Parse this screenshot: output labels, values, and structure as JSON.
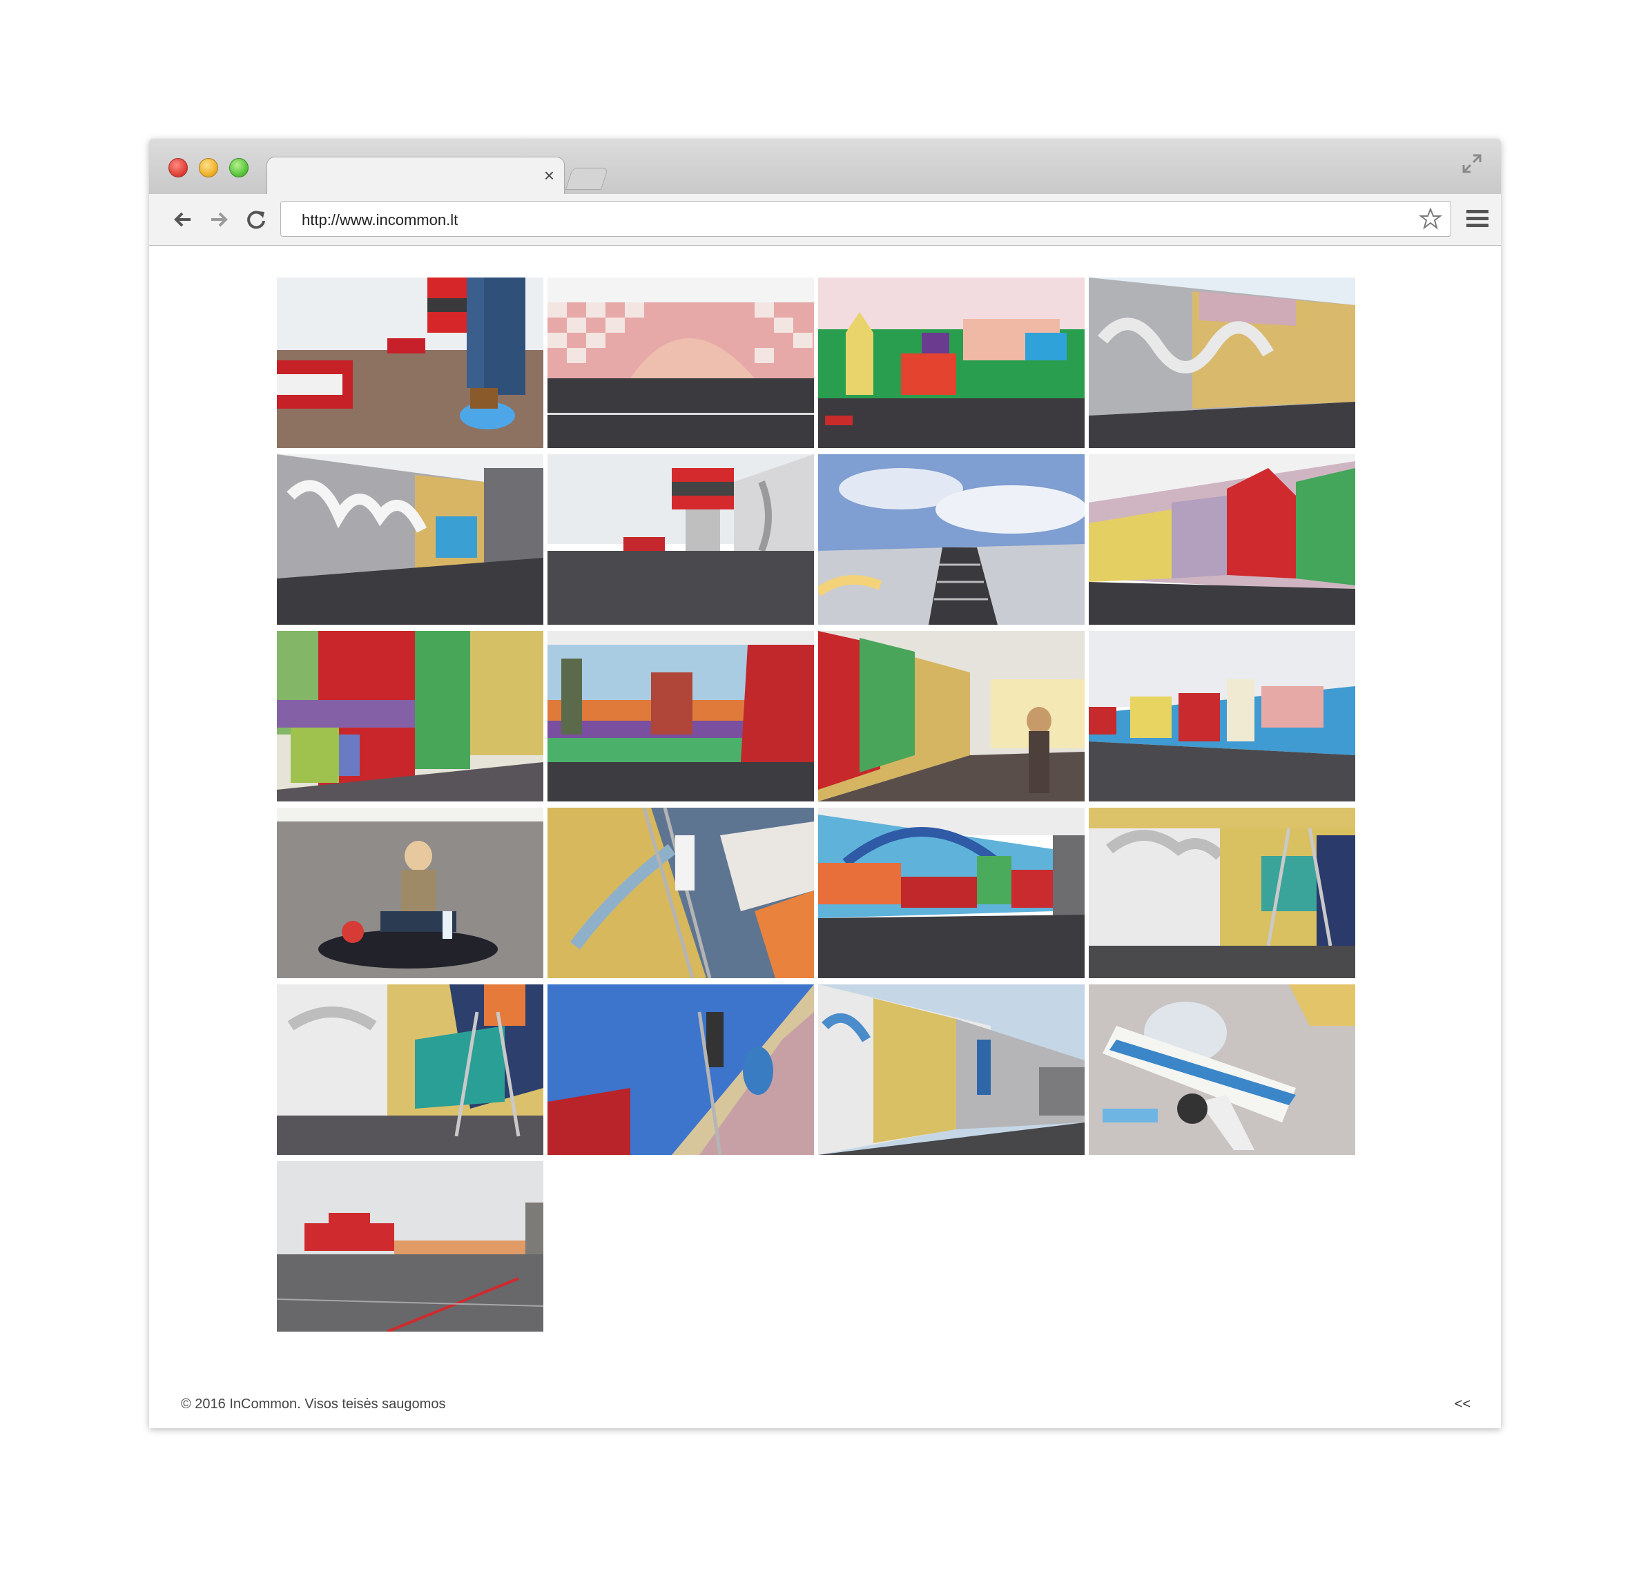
{
  "browser": {
    "url": "http://www.incommon.lt",
    "tab_close": "×"
  },
  "gallery": {
    "photos": [
      {
        "name": "fire-truck-runway-photo"
      },
      {
        "name": "checkered-wall-photo"
      },
      {
        "name": "spray-can-mural-photo"
      },
      {
        "name": "graffiti-wall-photo"
      },
      {
        "name": "vilnius-graffiti-photo"
      },
      {
        "name": "control-tower-photo"
      },
      {
        "name": "sky-roof-photo"
      },
      {
        "name": "cathedral-mural-photo"
      },
      {
        "name": "red-wall-painter-photo"
      },
      {
        "name": "castle-mural-photo"
      },
      {
        "name": "sunset-person-photo"
      },
      {
        "name": "full-mural-photo"
      },
      {
        "name": "woman-paints-photo"
      },
      {
        "name": "ladder-painter-photo"
      },
      {
        "name": "bridge-mural-photo"
      },
      {
        "name": "clouds-mural-photo"
      },
      {
        "name": "two-painters-photo"
      },
      {
        "name": "painter-sky-photo"
      },
      {
        "name": "long-wall-photo"
      },
      {
        "name": "airplane-mural-photo"
      },
      {
        "name": "airport-view-photo"
      }
    ]
  },
  "footer": {
    "copyright": "© 2016 InCommon. Visos teisės saugomos",
    "back_link": "<<"
  },
  "colors": {
    "chrome": "#d0d0d0",
    "toolbar": "#f2f2f2",
    "page": "#ffffff"
  }
}
